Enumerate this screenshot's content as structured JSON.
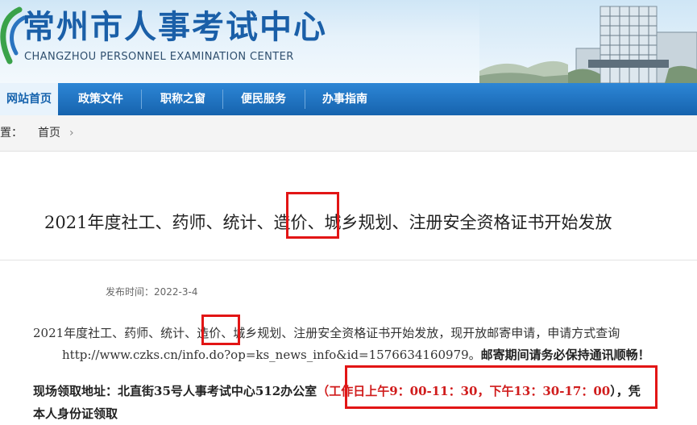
{
  "header": {
    "title_cn": "常州市人事考试中心",
    "title_en": "CHANGZHOU PERSONNEL EXAMINATION CENTER"
  },
  "nav": {
    "items": [
      {
        "label": "网站首页"
      },
      {
        "label": "政策文件"
      },
      {
        "label": "职称之窗"
      },
      {
        "label": "便民服务"
      },
      {
        "label": "办事指南"
      }
    ]
  },
  "breadcrumb": {
    "prefix": "位置：",
    "home": "首页",
    "separator": "›"
  },
  "article": {
    "title_part1": "2021年度社工、药师、统计、",
    "title_highlight": "造价",
    "title_part2": "、城乡规划、注册安全资格证书开始发放",
    "publish": "发布时间：2022-3-4",
    "para1_part1": "2021年度社工、药师、统计、",
    "para1_highlight": "造价",
    "para1_part2": "、城乡规划、注册安全资格证书开始发放，现开放邮寄申请，申请方式查询",
    "para1_url": "http://www.czks.cn/info.do?op=ks_news_info&id=1576634160979。",
    "para1_bold": "邮寄期间请务必保持通讯顺畅！",
    "para2_label": "现场领取地址：北直街35号人事考试中心512办公室",
    "para2_open": "（",
    "para2_hours": "工作日上午9：00-11：30，下午13：30-17：00",
    "para2_close": "）",
    "para2_tail": "，凭",
    "para2_line2": "本人身份证领取"
  },
  "colors": {
    "brand_blue": "#1663ad",
    "highlight_red": "#e21515"
  }
}
